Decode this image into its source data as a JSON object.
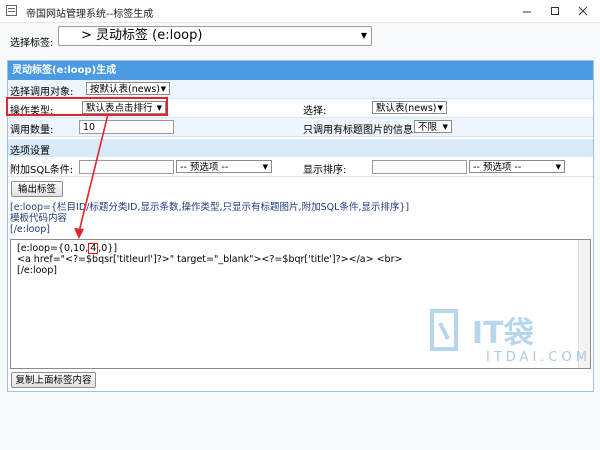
{
  "window": {
    "title": "帝国网站管理系统--标签生成"
  },
  "selector": {
    "label": "选择标签:",
    "value": "> 灵动标签 (e:loop)"
  },
  "panel": {
    "header": "灵动标签(e:loop)生成",
    "call_object": {
      "label": "选择调用对象:",
      "value": "按默认表(news)"
    },
    "operation_type": {
      "label": "操作类型:",
      "value": "默认表点击排行"
    },
    "choose": {
      "label": "选择:",
      "value": "默认表(news)"
    },
    "count": {
      "label": "调用数量:",
      "value": "10"
    },
    "title_pic_only": {
      "label": "只调用有标题图片的信息:",
      "value": "不限"
    },
    "options_section": "选项设置",
    "extra_sql": {
      "label": "附加SQL条件:",
      "value": "",
      "preset": "-- 预选项 --"
    },
    "sort": {
      "label": "显示排序:",
      "value": "",
      "preset": "-- 预选项 --"
    },
    "output_button": "输出标签",
    "help_lines": [
      "[e:loop={栏目ID/标题分类ID,显示条数,操作类型,只显示有标题图片,附加SQL条件,显示排序}]",
      "模板代码内容",
      "[/e:loop]"
    ],
    "code": {
      "line1_pre": "[e:loop={0,10,",
      "line1_hl": "4",
      "line1_post": ",0}]",
      "line2": "<a href=\"<?=$bqsr['titleurl']?>\" target=\"_blank\"><?=$bqr['title']?></a> <br>",
      "line3": "[/e:loop]"
    },
    "copy_button": "复制上面标签内容"
  },
  "watermark": {
    "brand": "IT袋",
    "url": "ITDAI.COM"
  },
  "colors": {
    "header_blue": "#4a9be3",
    "annotation_red": "#e0262b",
    "section_blue": "#d9eafb"
  }
}
